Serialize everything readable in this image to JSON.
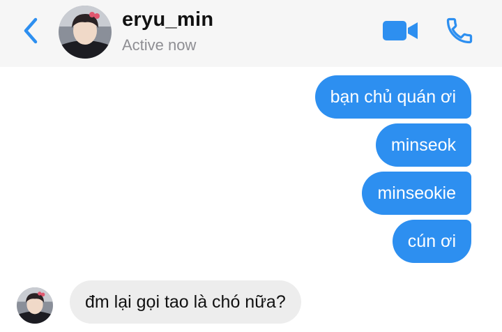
{
  "header": {
    "contact_name": "eryu_min",
    "status": "Active now",
    "back_icon": "chevron-left-icon",
    "video_icon": "video-camera-icon",
    "phone_icon": "phone-icon"
  },
  "colors": {
    "accent": "#2d8ff0",
    "header_bg": "#f6f6f6",
    "incoming_bubble": "#ededed",
    "status_text": "#8e8e93"
  },
  "messages": [
    {
      "direction": "outgoing",
      "text": "bạn chủ quán ơi"
    },
    {
      "direction": "outgoing",
      "text": "minseok"
    },
    {
      "direction": "outgoing",
      "text": "minseokie"
    },
    {
      "direction": "outgoing",
      "text": "cún ơi"
    },
    {
      "direction": "incoming",
      "text": "đm lại gọi tao là chó nữa?"
    }
  ]
}
